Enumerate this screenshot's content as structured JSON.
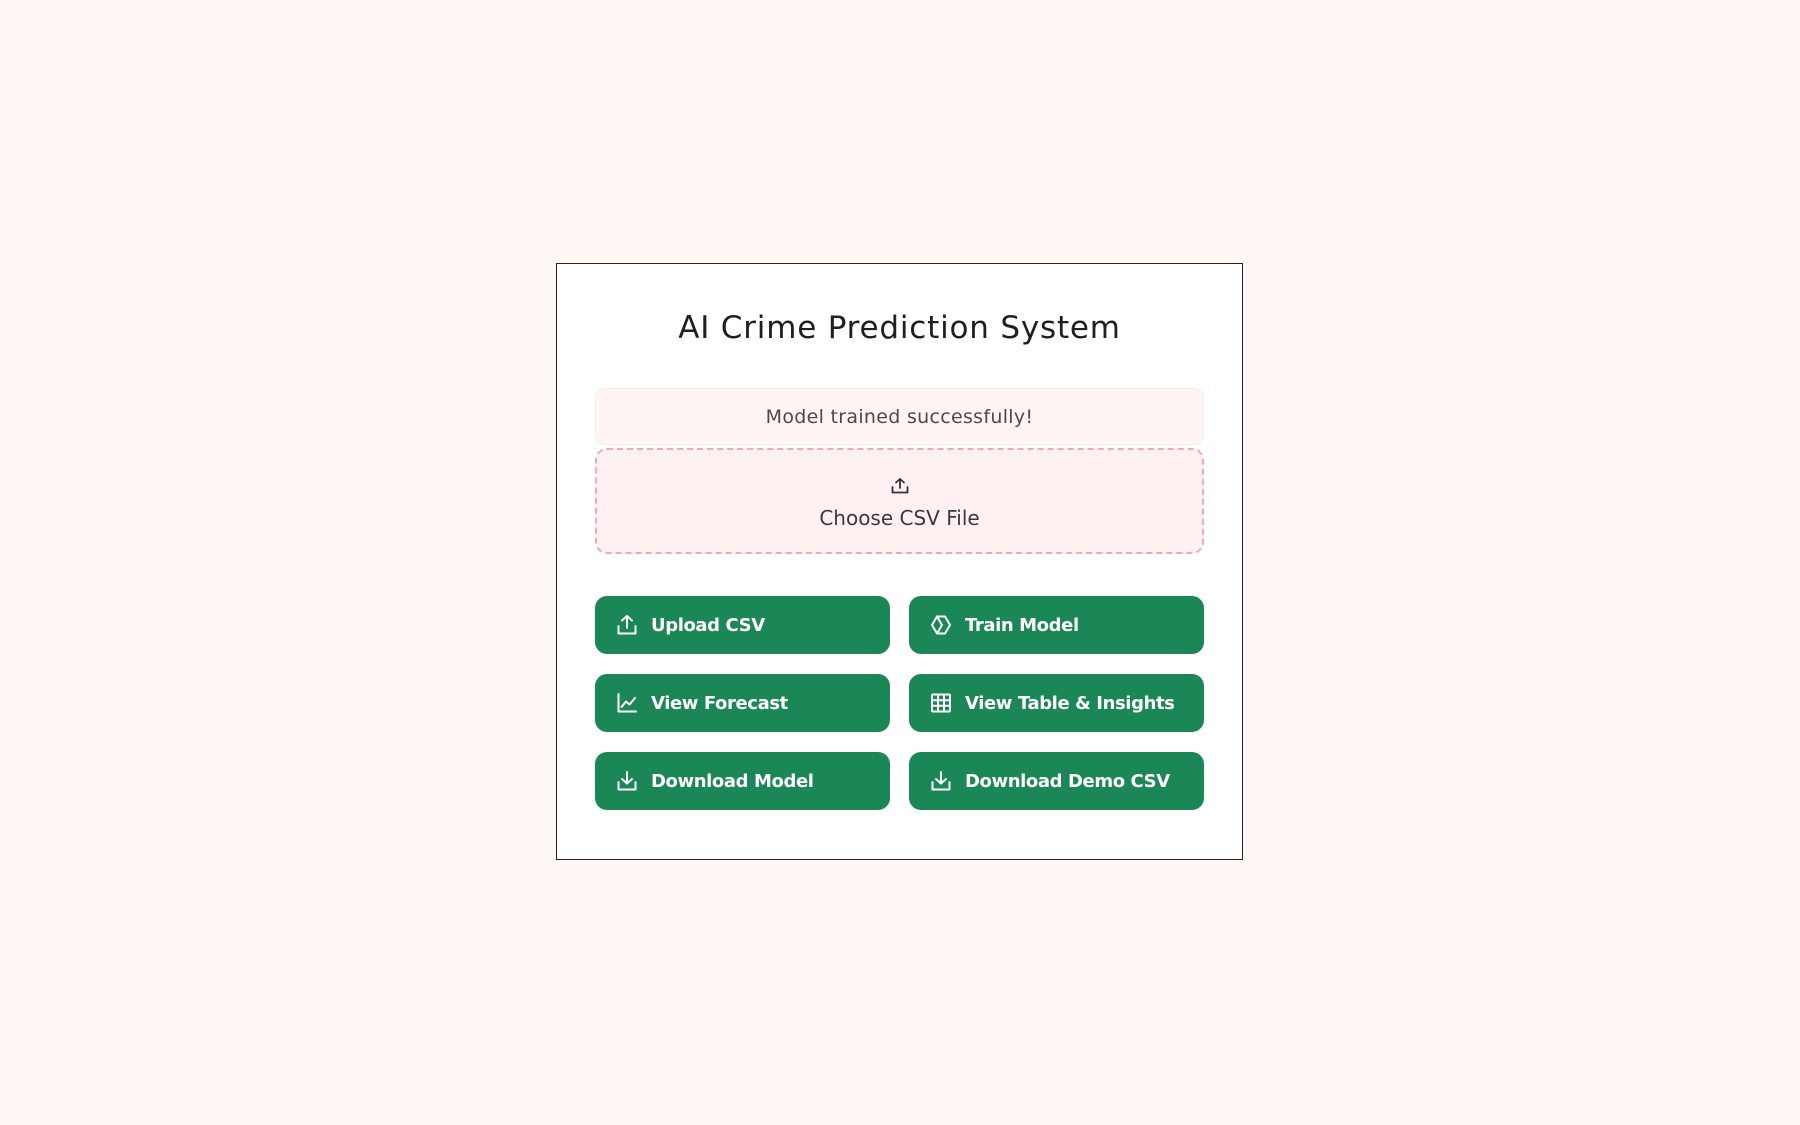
{
  "app": {
    "title": "AI Crime Prediction System"
  },
  "status": {
    "message": "Model trained successfully!"
  },
  "file_picker": {
    "label": "Choose CSV File",
    "icon": "upload-icon"
  },
  "actions": [
    {
      "label": "Upload CSV",
      "icon": "upload-icon"
    },
    {
      "label": "Train Model",
      "icon": "hexagon-icon"
    },
    {
      "label": "View Forecast",
      "icon": "line-chart-icon"
    },
    {
      "label": "View Table & Insights",
      "icon": "table-icon"
    },
    {
      "label": "Download Model",
      "icon": "download-icon"
    },
    {
      "label": "Download Demo CSV",
      "icon": "download-icon"
    }
  ],
  "colors": {
    "background": "#fff8f4",
    "card": "#ffffff",
    "button": "#1b8757",
    "dropzone_border": "#eeaab6",
    "dropzone_fill": "#fff1f1"
  }
}
